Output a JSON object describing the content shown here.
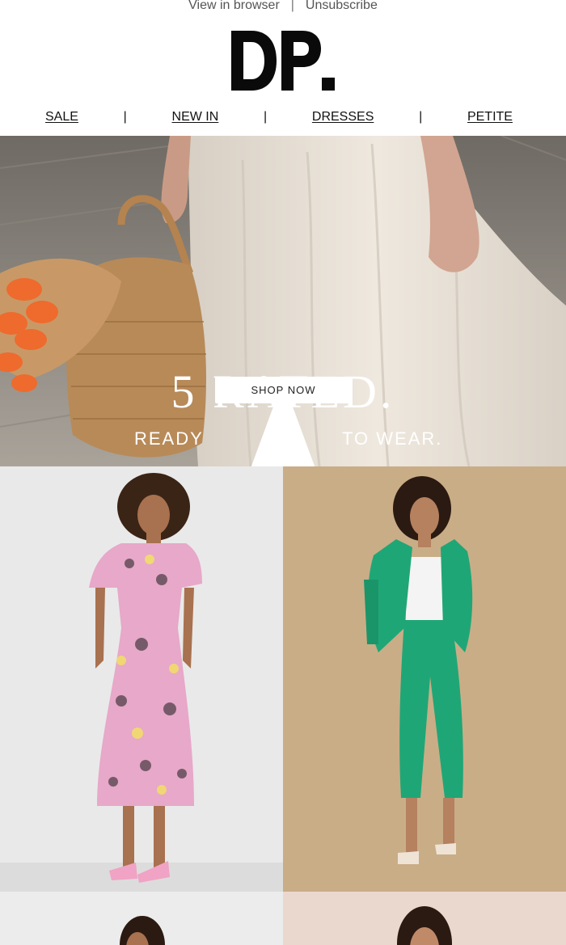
{
  "topbar": {
    "view_in_browser": "View in browser",
    "separator": "|",
    "unsubscribe": "Unsubscribe"
  },
  "brand": {
    "logo_alt": "DP."
  },
  "nav": {
    "items": [
      {
        "label": "SALE"
      },
      {
        "label": "NEW IN"
      },
      {
        "label": "DRESSES"
      },
      {
        "label": "PETITE"
      }
    ],
    "separator": "|"
  },
  "hero": {
    "title_number": "5",
    "title_word": "RATED.",
    "subtitle_left": "READY",
    "subtitle_right": "TO WEAR.",
    "cta_label": "SHOP NOW"
  },
  "colors": {
    "hero_bg": "#d9d2c9",
    "tile1_bg": "#e9e9e9",
    "tile2_bg": "#c9ad87",
    "tile3_bg": "#ececec",
    "tile4_bg": "#ead8cf",
    "suit_green": "#1fa676"
  },
  "icons": {
    "star": "star-icon"
  }
}
